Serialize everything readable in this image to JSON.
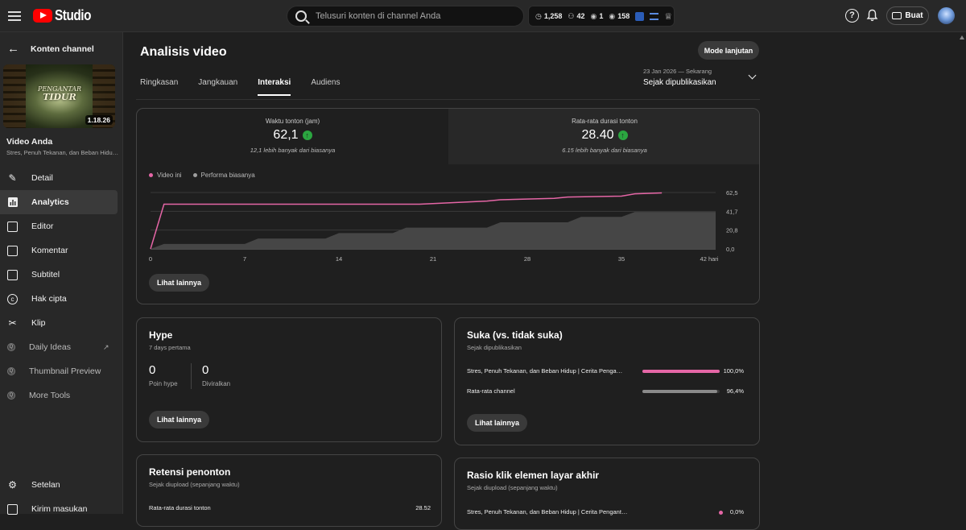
{
  "header": {
    "logo_text": "Studio",
    "search_placeholder": "Telusuri konten di channel Anda",
    "stats": [
      {
        "icon": "clock-icon",
        "value": "1,258"
      },
      {
        "icon": "person-icon",
        "value": "42"
      },
      {
        "icon": "eye-icon",
        "value": "1"
      },
      {
        "icon": "eye-icon",
        "value": "158"
      }
    ],
    "create_label": "Buat"
  },
  "sidebar": {
    "back_label": "Konten channel",
    "thumbnail": {
      "title_line1": "PENGANTAR",
      "title_line2": "TIDUR",
      "duration": "1.18.26"
    },
    "video_label": "Video Anda",
    "video_title": "Stres, Penuh Tekanan, dan Beban Hidup | Cerita Pengantar Tidur",
    "items": [
      {
        "label": "Detail",
        "icon": "pencil-icon"
      },
      {
        "label": "Analytics",
        "icon": "analytics-icon"
      },
      {
        "label": "Editor",
        "icon": "editor-icon"
      },
      {
        "label": "Komentar",
        "icon": "comment-icon"
      },
      {
        "label": "Subtitel",
        "icon": "subtitles-icon"
      },
      {
        "label": "Hak cipta",
        "icon": "copyright-icon"
      },
      {
        "label": "Klip",
        "icon": "scissors-icon"
      },
      {
        "label": "Daily Ideas",
        "icon": "extension-icon"
      },
      {
        "label": "Thumbnail Preview",
        "icon": "extension-icon"
      },
      {
        "label": "More Tools",
        "icon": "extension-icon"
      }
    ],
    "bottom": [
      {
        "label": "Setelan",
        "icon": "gear-icon"
      },
      {
        "label": "Kirim masukan",
        "icon": "feedback-icon"
      }
    ]
  },
  "main": {
    "title": "Analisis video",
    "mode_button": "Mode lanjutan",
    "tabs": [
      "Ringkasan",
      "Jangkauan",
      "Interaksi",
      "Audiens"
    ],
    "active_tab": "Interaksi",
    "date_range": {
      "range": "23 Jan 2026 — Sekarang",
      "label": "Sejak dipublikasikan"
    },
    "metrics": [
      {
        "label": "Waktu tonton (jam)",
        "value": "62,1",
        "note": "12,1 lebih banyak dari biasanya"
      },
      {
        "label": "Rata-rata durasi tonton",
        "value": "28.40",
        "note": "6.15 lebih banyak dari biasanya"
      }
    ],
    "see_more": "Lihat lainnya"
  },
  "chart_data": {
    "type": "line",
    "series": [
      {
        "name": "Video ini",
        "color": "#e566a6",
        "x": [
          0,
          1,
          2,
          5,
          10,
          15,
          20,
          25,
          26,
          30,
          31,
          35,
          36,
          38
        ],
        "y": [
          0,
          49.5,
          49.5,
          49.5,
          49.5,
          49.5,
          49.6,
          53.0,
          54.5,
          56.0,
          57.5,
          58.5,
          61.0,
          62.1
        ]
      },
      {
        "name": "Performa biasanya",
        "color": "#9e9e9e",
        "type": "area",
        "x": [
          0,
          1,
          7,
          8,
          13,
          14,
          18,
          19,
          25,
          26,
          31,
          32,
          35,
          36,
          42
        ],
        "y": [
          0,
          5.5,
          5.5,
          11.5,
          11.5,
          17.5,
          17.5,
          23.5,
          23.5,
          29.5,
          29.5,
          35.5,
          35.5,
          41.0,
          41.0
        ]
      }
    ],
    "x_ticks": [
      "0",
      "7",
      "14",
      "21",
      "28",
      "35",
      "42 hari"
    ],
    "y_ticks": [
      "62,5",
      "41,7",
      "20,8",
      "0,0"
    ],
    "xlim": [
      0,
      42
    ],
    "ylim": [
      0,
      62.5
    ],
    "legend_position": "top-left",
    "grid": true
  },
  "hype": {
    "title": "Hype",
    "subtitle": "7 days pertama",
    "points_value": "0",
    "points_label": "Poin hype",
    "promoted_value": "0",
    "promoted_label": "Diviralkan",
    "see_more": "Lihat lainnya"
  },
  "likes": {
    "title": "Suka (vs. tidak suka)",
    "subtitle": "Sejak dipublikasikan",
    "rows": [
      {
        "name": "Stres, Penuh Tekanan, dan Beban Hidup | Cerita Pengantar Tidur",
        "value": "100,0%",
        "fraction": 1.0,
        "color": "#e566a6"
      },
      {
        "name": "Rata-rata channel",
        "value": "96,4%",
        "fraction": 0.964,
        "color": "#8a8a8a"
      }
    ],
    "see_more": "Lihat lainnya"
  },
  "retention": {
    "title": "Retensi penonton",
    "subtitle": "Sejak diupload (sepanjang waktu)",
    "row_label": "Rata-rata durasi tonton",
    "row_value": "28.52"
  },
  "end_screen": {
    "title": "Rasio klik elemen layar akhir",
    "subtitle": "Sejak diupload (sepanjang waktu)",
    "row_label": "Stres, Penuh Tekanan, dan Beban Hidup | Cerita Pengantar Tidur",
    "row_value": "0,0%"
  }
}
